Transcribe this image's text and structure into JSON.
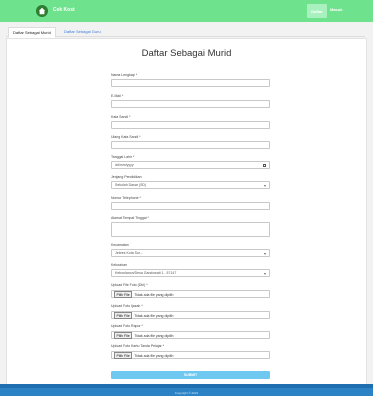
{
  "header": {
    "brand": "Cek Kost",
    "nav_daftar": "Daftar",
    "nav_masuk": "Masuk"
  },
  "tabs": [
    {
      "label": "Daftar Sebagai Murid"
    },
    {
      "label": "Daftar Sebagai Guru"
    }
  ],
  "form": {
    "title": "Daftar Sebagai Murid",
    "fields": {
      "nama": {
        "label": "Nama Lengkap *",
        "value": ""
      },
      "email": {
        "label": "E-Mail *",
        "value": ""
      },
      "password": {
        "label": "Kata Sandi *",
        "value": ""
      },
      "password_confirm": {
        "label": "Ulang Kata Sandi *",
        "value": ""
      },
      "tanggal_lahir": {
        "label": "Tanggal Lahir *",
        "value": "dd/mm/yyyy"
      },
      "jenjang": {
        "label": "Jenjang Pendidikan",
        "value": "Sekolah Dasar (SD)"
      },
      "telepon": {
        "label": "Nomor Telephone *",
        "value": ""
      },
      "alamat": {
        "label": "Alamat Tempat Tinggal *",
        "value": ""
      },
      "kecamatan": {
        "label": "Kecamatan",
        "value": "Jebres Kota Sur..."
      },
      "kelurahan": {
        "label": "Kelurahan",
        "value": "Kebonlanon/Desa Gandowati 1 - 57147"
      },
      "foto_diri": {
        "label": "Upload File Foto (Diri) *"
      },
      "foto_ijazah": {
        "label": "Upload Foto Ijazah *"
      },
      "foto_rapor": {
        "label": "Upload Foto Rapor *"
      },
      "foto_kartu": {
        "label": "Upload Foto Kartu Tanda Pelajar *"
      }
    },
    "file_button": "Pilih File",
    "no_file_text": "Tidak ada file yang dipilih",
    "submit": "SUBMIT"
  },
  "footer": {
    "text": "Copyright © 2021"
  },
  "colors": {
    "topbar": "#6fe28d",
    "submit": "#6ec8f0",
    "footer": "#2b83c6",
    "link": "#3b7dd8"
  }
}
